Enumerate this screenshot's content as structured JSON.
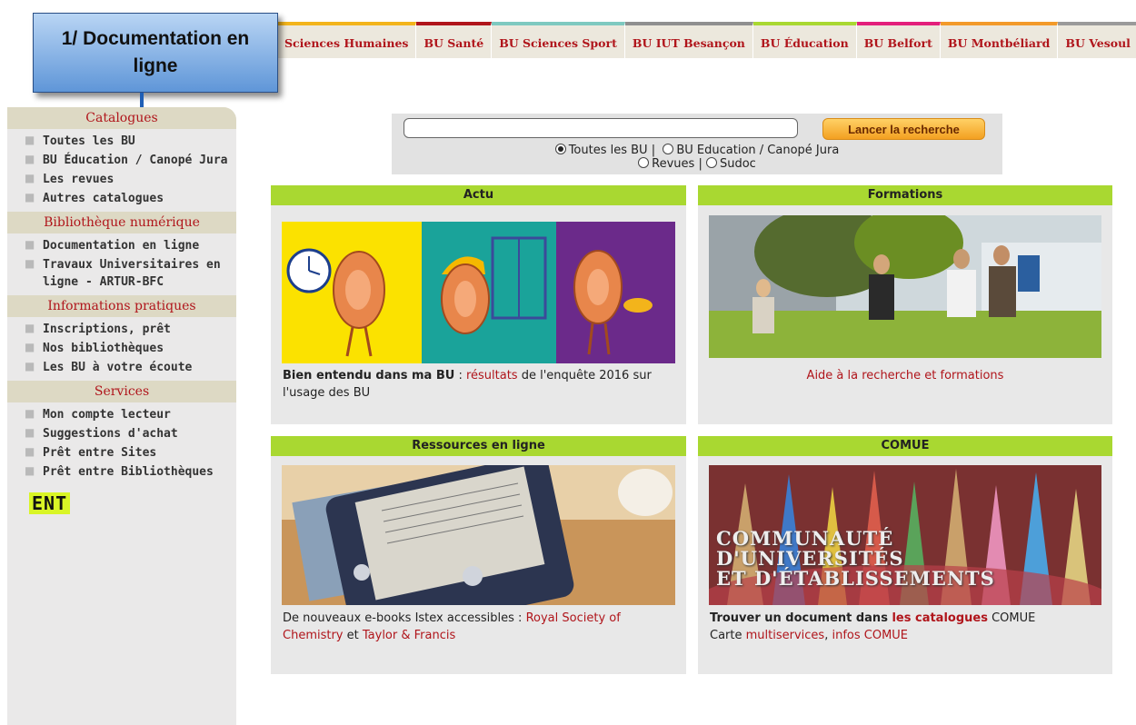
{
  "topnav": {
    "tabs": [
      {
        "label": "Sciences Humaines",
        "color": "#f3b41b"
      },
      {
        "label": "BU Santé",
        "color": "#b0151b"
      },
      {
        "label": "BU Sciences Sport",
        "color": "#7ec9c0"
      },
      {
        "label": "BU IUT Besançon",
        "color": "#8f8f8f"
      },
      {
        "label": "BU Éducation",
        "color": "#a9d831"
      },
      {
        "label": "BU Belfort",
        "color": "#e31f7b"
      },
      {
        "label": "BU Montbéliard",
        "color": "#f39a2a"
      },
      {
        "label": "BU Vesoul",
        "color": "#9a9a9a"
      }
    ]
  },
  "callout": {
    "text": "1/ Documentation en ligne"
  },
  "sidebar": {
    "sections": [
      {
        "title": "Catalogues",
        "items": [
          "Toutes les BU",
          "BU Éducation / Canopé Jura",
          "Les revues",
          "Autres catalogues"
        ]
      },
      {
        "title": "Bibliothèque numérique",
        "items": [
          "Documentation en ligne",
          "Travaux Universitaires en ligne - ARTUR-BFC"
        ]
      },
      {
        "title": "Informations pratiques",
        "items": [
          "Inscriptions, prêt",
          "Nos bibliothèques",
          "Les BU à votre écoute"
        ]
      },
      {
        "title": "Services",
        "items": [
          "Mon compte lecteur",
          "Suggestions d'achat",
          "Prêt entre Sites",
          "Prêt entre Bibliothèques"
        ]
      }
    ],
    "ent_label": "ENT"
  },
  "search": {
    "button_label": "Lancer la recherche",
    "input_value": "",
    "options": {
      "all": "Toutes les BU |",
      "edu": "BU Education / Canopé Jura",
      "revues": "Revues |",
      "sudoc": "Sudoc"
    },
    "selected": "all"
  },
  "boxes": {
    "actu": {
      "title": "Actu",
      "bold_text": "Bien entendu dans ma BU",
      "sep": " : ",
      "link": "résultats",
      "text_after": " de l'enquête 2016 sur l'usage des BU"
    },
    "formations": {
      "title": "Formations",
      "link": "Aide à la recherche et formations"
    },
    "ressources": {
      "title": "Ressources en ligne",
      "text_before": "De nouveaux e-books Istex accessibles : ",
      "link1": "Royal Society of Chemistry",
      "text_mid": " et ",
      "link2": "Taylor & Francis"
    },
    "comue": {
      "title": "COMUE",
      "bold_text": "Trouver un document dans ",
      "bold_link": "les catalogues",
      "text_after": " COMUE",
      "line2_text": "Carte ",
      "link1": "multiservices",
      "sep": ", ",
      "link2": "infos COMUE",
      "image_text": [
        "COMMUNAUTÉ",
        "D'UNIVERSITÉS",
        "ET D'ÉTABLISSEMENTS"
      ]
    }
  }
}
